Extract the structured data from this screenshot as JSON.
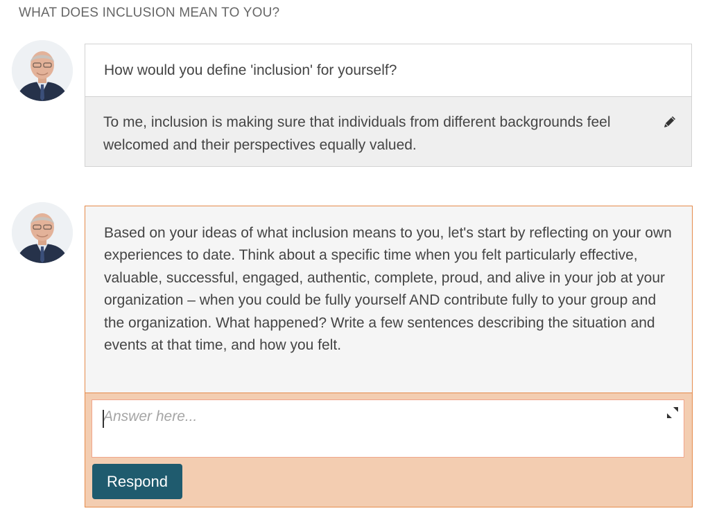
{
  "section": {
    "title": "WHAT DOES INCLUSION MEAN TO YOU?"
  },
  "first_exchange": {
    "question": "How would you define 'inclusion' for yourself?",
    "answer": "To me, inclusion is making sure that individuals from different backgrounds feel welcomed and their perspectives equally valued.",
    "edit_icon": "pencil-icon"
  },
  "second_exchange": {
    "prompt": "Based on your ideas of what inclusion means to you, let's start by reflecting on your own experiences to date. Think about a specific time when you felt particularly effective, valuable, successful, engaged, authentic, complete, proud, and alive in your job at your organization – when you could be fully yourself AND contribute fully to your group and the organization. What happened? Write a few sentences describing the situation and events at that time, and how you felt.",
    "answer_value": "",
    "answer_placeholder": "Answer here...",
    "expand_icon": "expand-icon",
    "respond_label": "Respond"
  },
  "colors": {
    "accent_border": "#e58a4a",
    "respond_area_bg": "#f3cdb1",
    "button_bg": "#1f5b6e",
    "answer_bg": "#efefef"
  }
}
